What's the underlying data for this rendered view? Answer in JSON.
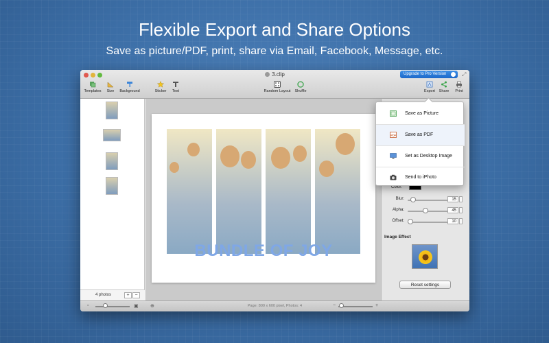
{
  "headline": "Flexible Export and Share Options",
  "subheadline": "Save as picture/PDF, print, share via Email, Facebook, Message, etc.",
  "window": {
    "title": "3.clip",
    "upgrade_label": "Upgrade to Pro Version",
    "toolbar": {
      "templates": "Templates",
      "size": "Size",
      "background": "Background",
      "sticker": "Sticker",
      "text": "Text",
      "random_layout": "Random Layout",
      "shuffle": "Shuffle",
      "export": "Export",
      "share": "Share",
      "print": "Print"
    }
  },
  "left_panel": {
    "photos_count": "4 photos",
    "add_label": "+",
    "remove_label": "−"
  },
  "canvas": {
    "text": "BUNDLE OF JOY"
  },
  "right_panel": {
    "color_label": "Color:",
    "blur_label": "Blur:",
    "blur_value": "15",
    "alpha_label": "Alpha:",
    "alpha_value": "45",
    "offset_label": "Offset:",
    "offset_value": "10",
    "image_effect_title": "Image Effect",
    "reset_label": "Reset settings"
  },
  "status_bar": {
    "status_text": "Page: 800 x 600 pixel, Photos: 4"
  },
  "export_menu": {
    "items": [
      {
        "label": "Save as Picture",
        "icon": "picture-icon"
      },
      {
        "label": "Save as PDF",
        "icon": "pdf-icon"
      },
      {
        "label": "Set as Desktop Image",
        "icon": "desktop-icon"
      },
      {
        "label": "Send to iPhoto",
        "icon": "camera-icon"
      }
    ]
  },
  "colors": {
    "background": "#3c6ea6",
    "accent": "#1d68c9",
    "canvas_text": "#7fa7e6"
  }
}
